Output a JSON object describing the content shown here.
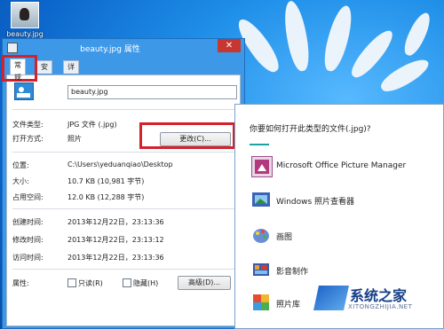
{
  "desktop": {
    "icon_label": "beauty.jpg"
  },
  "dialog": {
    "title": "beauty.jpg 属性",
    "close_symbol": "✕",
    "tabs": [
      "常规",
      "安全",
      "详细信息"
    ],
    "filename": "beauty.jpg",
    "rows": {
      "type_label": "文件类型:",
      "type_value": "JPG 文件 (.jpg)",
      "open_label": "打开方式:",
      "open_value": "照片",
      "change_button": "更改(C)...",
      "location_label": "位置:",
      "location_value": "C:\\Users\\yeduanqiao\\Desktop",
      "size_label": "大小:",
      "size_value": "10.7 KB (10,981 字节)",
      "disk_label": "占用空间:",
      "disk_value": "12.0 KB (12,288 字节)",
      "created_label": "创建时间:",
      "created_value": "2013年12月22日，23:13:36",
      "modified_label": "修改时间:",
      "modified_value": "2013年12月22日，23:13:12",
      "accessed_label": "访问时间:",
      "accessed_value": "2013年12月22日，23:13:36",
      "attr_label": "属性:",
      "readonly_label": "只读(R)",
      "hidden_label": "隐藏(H)",
      "advanced_button": "高级(D)..."
    }
  },
  "flyout": {
    "title": "你要如何打开此类型的文件(.jpg)?",
    "apps": [
      {
        "name": "Microsoft Office Picture Manager",
        "icon": "picture-manager-icon"
      },
      {
        "name": "Windows 照片查看器",
        "icon": "photo-viewer-icon"
      },
      {
        "name": "画图",
        "icon": "paint-icon"
      },
      {
        "name": "影音制作",
        "icon": "movie-maker-icon"
      },
      {
        "name": "照片库",
        "icon": "photo-gallery-icon"
      }
    ]
  },
  "watermark": {
    "text": "系统之家",
    "url": "XITONGZHIJIA.NET"
  },
  "colors": {
    "accent_red": "#d3222c",
    "flyout_accent": "#1aa3a3",
    "close_button": "#c7372f"
  }
}
